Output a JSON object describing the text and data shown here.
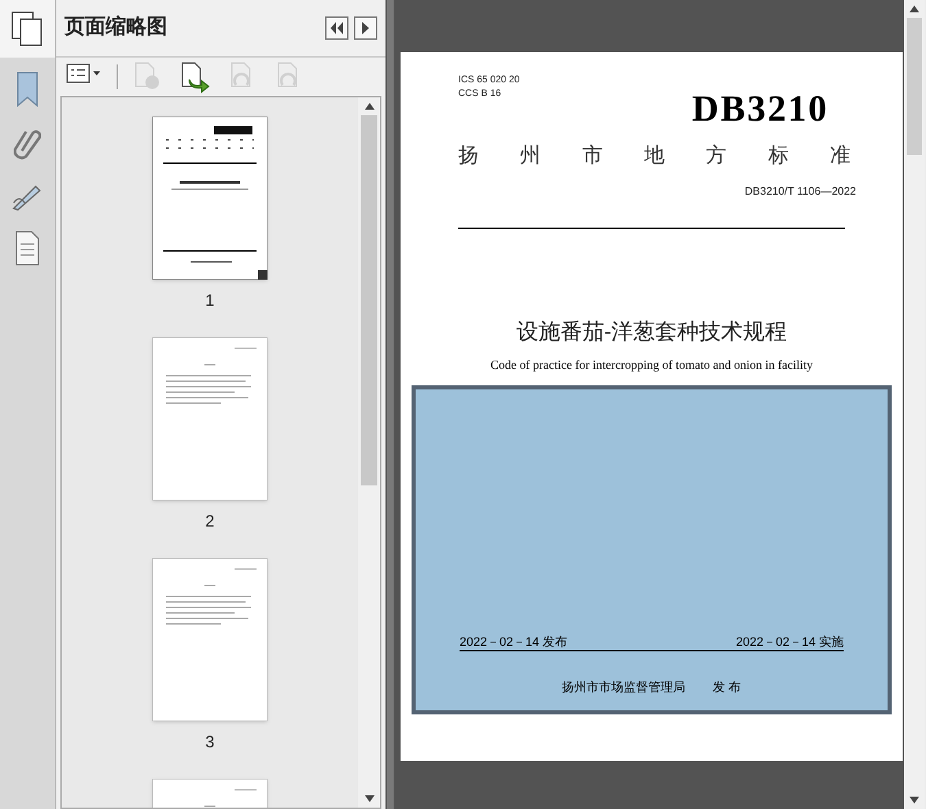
{
  "panel": {
    "title": "页面缩略图"
  },
  "toolbar": [
    {
      "kind": "options",
      "disabled": false
    },
    {
      "kind": "delete",
      "disabled": true
    },
    {
      "kind": "insert",
      "disabled": false
    },
    {
      "kind": "rotate",
      "disabled": true
    },
    {
      "kind": "rotate2",
      "disabled": true
    }
  ],
  "thumbnails": [
    {
      "label": "1",
      "kind": "cover",
      "selected": true
    },
    {
      "label": "2",
      "kind": "text",
      "selected": false
    },
    {
      "label": "3",
      "kind": "text",
      "selected": false
    },
    {
      "kind": "text",
      "selected": false
    }
  ],
  "document": {
    "ics": "ICS  65 020 20",
    "ccs": "CCS B  16",
    "code": "DB3210",
    "authority": "扬 州 市 地 方 标 准",
    "number": "DB3210/T 1106—2022",
    "title": "设施番茄-洋葱套种技术规程",
    "subtitle": "Code of practice for intercropping of tomato and onion in facility",
    "publish_date": "2022－02－14 发布",
    "effective_date": "2022－02－14 实施",
    "issuer": "扬州市市场监督管理局",
    "issue_word": "发  布"
  }
}
